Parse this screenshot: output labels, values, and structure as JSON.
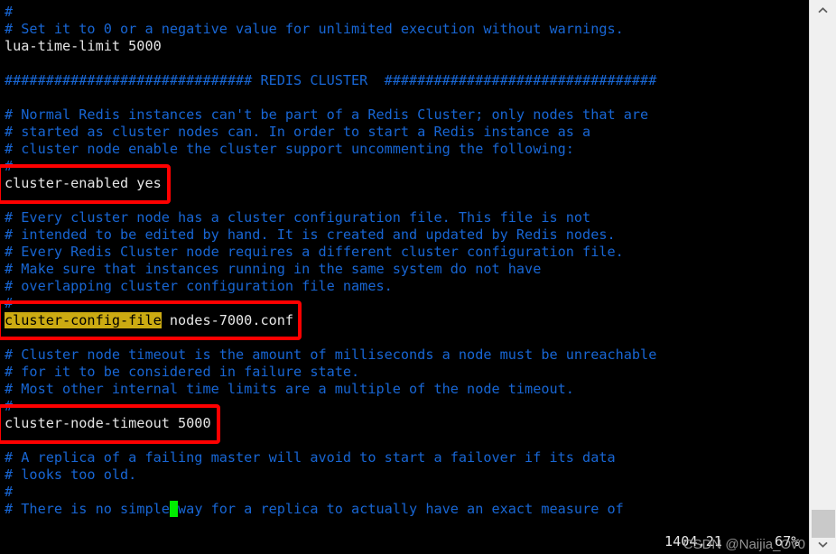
{
  "editor": {
    "file_lines": [
      {
        "type": "comment",
        "text": "#"
      },
      {
        "type": "comment",
        "text": "# Set it to 0 or a negative value for unlimited execution without warnings."
      },
      {
        "type": "code",
        "text": "lua-time-limit 5000"
      },
      {
        "type": "blank",
        "text": ""
      },
      {
        "type": "comment",
        "text": "############################## REDIS CLUSTER  #################################"
      },
      {
        "type": "blank",
        "text": ""
      },
      {
        "type": "comment",
        "text": "# Normal Redis instances can't be part of a Redis Cluster; only nodes that are"
      },
      {
        "type": "comment",
        "text": "# started as cluster nodes can. In order to start a Redis instance as a"
      },
      {
        "type": "comment",
        "text": "# cluster node enable the cluster support uncommenting the following:"
      },
      {
        "type": "comment",
        "text": "#"
      },
      {
        "type": "code",
        "text": "cluster-enabled yes"
      },
      {
        "type": "blank",
        "text": ""
      },
      {
        "type": "comment",
        "text": "# Every cluster node has a cluster configuration file. This file is not"
      },
      {
        "type": "comment",
        "text": "# intended to be edited by hand. It is created and updated by Redis nodes."
      },
      {
        "type": "comment",
        "text": "# Every Redis Cluster node requires a different cluster configuration file."
      },
      {
        "type": "comment",
        "text": "# Make sure that instances running in the same system do not have"
      },
      {
        "type": "comment",
        "text": "# overlapping cluster configuration file names."
      },
      {
        "type": "comment",
        "text": "#"
      },
      {
        "type": "code_highlight",
        "highlight": "cluster-config-file",
        "text": " nodes-7000.conf"
      },
      {
        "type": "blank",
        "text": ""
      },
      {
        "type": "comment",
        "text": "# Cluster node timeout is the amount of milliseconds a node must be unreachable"
      },
      {
        "type": "comment",
        "text": "# for it to be considered in failure state."
      },
      {
        "type": "comment",
        "text": "# Most other internal time limits are a multiple of the node timeout."
      },
      {
        "type": "comment",
        "text": "#"
      },
      {
        "type": "code",
        "text": "cluster-node-timeout 5000"
      },
      {
        "type": "blank",
        "text": ""
      },
      {
        "type": "comment",
        "text": "# A replica of a failing master will avoid to start a failover if its data"
      },
      {
        "type": "comment",
        "text": "# looks too old."
      },
      {
        "type": "comment",
        "text": "#"
      },
      {
        "type": "comment_cursor",
        "before": "# There is no simple",
        "cursor": " ",
        "after": "way for a replica to actually have an exact measure of"
      }
    ],
    "annotations": [
      {
        "label": "cluster-enabled-box"
      },
      {
        "label": "cluster-config-file-box"
      },
      {
        "label": "cluster-node-timeout-box"
      }
    ],
    "colors": {
      "comment": "#1866d4",
      "code": "#e6e6e6",
      "background": "#000000",
      "search_highlight_bg": "#ccab12",
      "search_highlight_fg": "#000000",
      "cursor": "#00ee00",
      "annotation_box": "#ff0000"
    }
  },
  "status": {
    "cursor_position": "1404,21",
    "scroll_percent": "67%"
  },
  "watermark": {
    "text": "CSDN @Naijia_Ov0"
  },
  "scrollbar": {
    "up_arrow_icon": "chevron-up-icon",
    "down_arrow_icon": "chevron-down-icon"
  }
}
